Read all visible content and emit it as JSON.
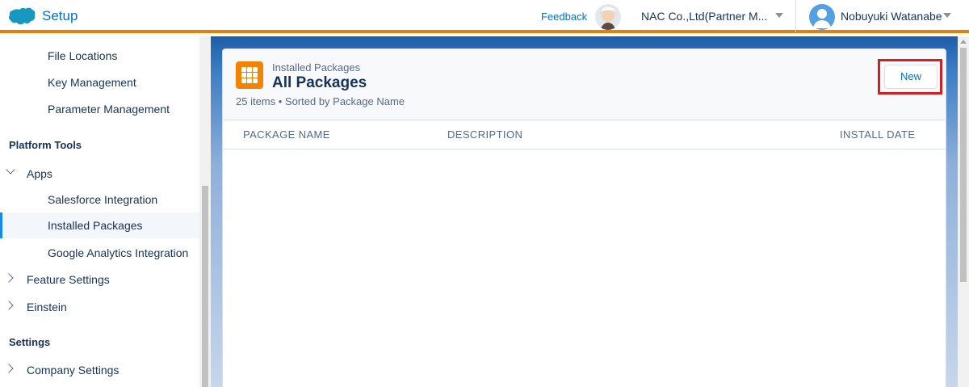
{
  "header": {
    "app_name": "Setup",
    "feedback": "Feedback",
    "org_name": "NAC Co.,Ltd(Partner M...",
    "user_name": "Nobuyuki Watanabe",
    "accent_color": "#e57f0a",
    "brand_color": "#0070d2"
  },
  "sidebar": {
    "items": [
      {
        "label": "File Locations"
      },
      {
        "label": "Key Management"
      },
      {
        "label": "Parameter Management"
      }
    ],
    "section_platform": "Platform Tools",
    "apps": {
      "label": "Apps",
      "expanded": true
    },
    "apps_children": [
      {
        "label": "Salesforce Integration"
      },
      {
        "label": "Installed Packages",
        "selected": true
      },
      {
        "label": "Google Analytics Integration"
      }
    ],
    "feature_settings": "Feature Settings",
    "einstein": "Einstein",
    "section_settings": "Settings",
    "company_settings": "Company Settings"
  },
  "page": {
    "eyebrow": "Installed Packages",
    "title": "All Packages",
    "meta": "25 items • Sorted by Package Name",
    "new_button": "New",
    "highlight_color": "#d21f24",
    "columns": [
      "PACKAGE NAME",
      "DESCRIPTION",
      "INSTALL DATE"
    ]
  },
  "icons": {
    "logo": "salesforce-cloud-icon",
    "package": "app-grid-icon",
    "einstein": "einstein-avatar-icon",
    "user": "user-avatar-icon"
  }
}
